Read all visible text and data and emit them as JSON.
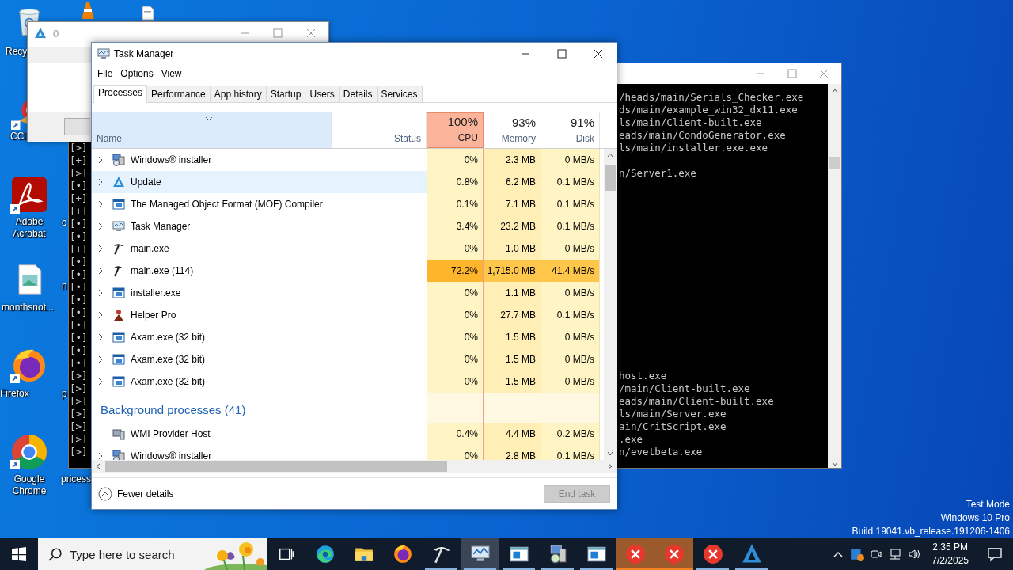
{
  "desktop": {
    "icons": [
      {
        "label": "Recy",
        "kind": "recycle"
      },
      {
        "label": "CCl",
        "kind": "cleaner"
      },
      {
        "label": "Adobe Acrobat",
        "kind": "acrobat"
      },
      {
        "label": "monthsnot...",
        "kind": "image-file"
      },
      {
        "label": "Firefox",
        "kind": "firefox"
      },
      {
        "label": "Google Chrome",
        "kind": "chrome"
      },
      {
        "kind": "cone"
      },
      {
        "kind": "document"
      },
      {
        "label": "c"
      },
      {
        "label": "n"
      },
      {
        "label": "p"
      },
      {
        "label": "pricess"
      }
    ],
    "watermark": [
      "Test Mode",
      "Windows 10 Pro",
      "Build 19041.vb_release.191206-1406"
    ]
  },
  "console": {
    "lines": [
      {
        "tail": "/heads/main/Serials_Checker.exe"
      },
      {
        "tail": "ds/main/example_win32_dx11.exe"
      },
      {
        "tail": "ls/main/Client-built.exe"
      },
      {
        "tail": "eads/main/CondoGenerator.exe"
      },
      {
        "marker": "[>]",
        "tail": "ls/main/installer.exe.exe"
      },
      {
        "marker": "[+]"
      },
      {
        "marker": "[>]",
        "tail": "n/Server1.exe"
      },
      {
        "marker": "[•]"
      },
      {
        "marker": "[+]"
      },
      {
        "marker": "[+]"
      },
      {
        "marker": "[•]"
      },
      {
        "marker": "[•]"
      },
      {
        "marker": "[+]"
      },
      {
        "marker": "[•]"
      },
      {
        "marker": "[•]"
      },
      {
        "marker": "[•]"
      },
      {
        "marker": "[•]"
      },
      {
        "marker": "[•]"
      },
      {
        "marker": "[•]"
      },
      {
        "marker": "[•]"
      },
      {
        "marker": "[•]"
      },
      {
        "marker": "[•]"
      },
      {
        "marker": "[>]",
        "tail": "host.exe"
      },
      {
        "marker": "[>]",
        "tail": "/main/Client-built.exe"
      },
      {
        "marker": "[>]",
        "tail": "eads/main/Client-built.exe"
      },
      {
        "marker": "[>]",
        "tail": "ls/main/Server.exe"
      },
      {
        "marker": "[>]",
        "tail": "ain/CritScript.exe"
      },
      {
        "marker": "[>]",
        "tail": ".exe"
      },
      {
        "marker": "[>]",
        "tail": "n/evetbeta.exe"
      }
    ]
  },
  "dialog": {
    "title": "0"
  },
  "task_manager": {
    "title": "Task Manager",
    "menu": [
      "File",
      "Options",
      "View"
    ],
    "tabs": [
      {
        "label": "Processes",
        "selected": true
      },
      {
        "label": "Performance",
        "selected": false
      },
      {
        "label": "App history",
        "selected": false
      },
      {
        "label": "Startup",
        "selected": false
      },
      {
        "label": "Users",
        "selected": false
      },
      {
        "label": "Details",
        "selected": false
      },
      {
        "label": "Services",
        "selected": false
      }
    ],
    "columns": [
      {
        "label": "Name",
        "sorted": true,
        "hot": false
      },
      {
        "label": "Status",
        "sorted": false,
        "hot": false
      },
      {
        "label": "CPU",
        "load": "100%",
        "sorted": false,
        "hot": true
      },
      {
        "label": "Memory",
        "load": "93%",
        "sorted": false,
        "hot": false
      },
      {
        "label": "Disk",
        "load": "91%",
        "sorted": false,
        "hot": false
      }
    ],
    "rows": [
      {
        "kind": "installer",
        "name": "Windows® installer",
        "expandable": true,
        "selected": false,
        "heavy": false,
        "cpu": "0%",
        "memory": "2.3 MB",
        "disk": "0 MB/s"
      },
      {
        "kind": "update",
        "name": "Update",
        "expandable": true,
        "selected": true,
        "heavy": false,
        "cpu": "0.8%",
        "memory": "6.2 MB",
        "disk": "0.1 MB/s"
      },
      {
        "kind": "window",
        "name": "The Managed Object Format (MOF) Compiler",
        "expandable": true,
        "selected": false,
        "heavy": false,
        "cpu": "0.1%",
        "memory": "7.1 MB",
        "disk": "0.1 MB/s"
      },
      {
        "kind": "monitor",
        "name": "Task Manager",
        "expandable": true,
        "selected": false,
        "heavy": false,
        "cpu": "3.4%",
        "memory": "23.2 MB",
        "disk": "0.1 MB/s"
      },
      {
        "kind": "hammer",
        "name": "main.exe",
        "expandable": true,
        "selected": false,
        "heavy": false,
        "cpu": "0%",
        "memory": "1.0 MB",
        "disk": "0 MB/s"
      },
      {
        "kind": "hammer",
        "name": "main.exe (114)",
        "expandable": true,
        "selected": false,
        "heavy": true,
        "cpu": "72.2%",
        "memory": "1,715.0 MB",
        "disk": "41.4 MB/s"
      },
      {
        "kind": "window",
        "name": "installer.exe",
        "expandable": true,
        "selected": false,
        "heavy": false,
        "cpu": "0%",
        "memory": "1.1 MB",
        "disk": "0 MB/s"
      },
      {
        "kind": "helper",
        "name": "Helper Pro",
        "expandable": true,
        "selected": false,
        "heavy": false,
        "cpu": "0%",
        "memory": "27.7 MB",
        "disk": "0.1 MB/s"
      },
      {
        "kind": "window",
        "name": "Axam.exe (32 bit)",
        "expandable": true,
        "selected": false,
        "heavy": false,
        "cpu": "0%",
        "memory": "1.5 MB",
        "disk": "0 MB/s"
      },
      {
        "kind": "window",
        "name": "Axam.exe (32 bit)",
        "expandable": true,
        "selected": false,
        "heavy": false,
        "cpu": "0%",
        "memory": "1.5 MB",
        "disk": "0 MB/s"
      },
      {
        "kind": "window",
        "name": "Axam.exe (32 bit)",
        "expandable": true,
        "selected": false,
        "heavy": false,
        "cpu": "0%",
        "memory": "1.5 MB",
        "disk": "0 MB/s"
      },
      {
        "kind": "group",
        "name": "Background processes (41)"
      },
      {
        "kind": "service",
        "name": "WMI Provider Host",
        "expandable": false,
        "selected": false,
        "heavy": false,
        "cpu": "0.4%",
        "memory": "4.4 MB",
        "disk": "0.2 MB/s"
      },
      {
        "kind": "installer",
        "name": "Windows® installer",
        "expandable": true,
        "selected": false,
        "heavy": false,
        "cpu": "0%",
        "memory": "2.8 MB",
        "disk": "0.1 MB/s"
      }
    ],
    "footer": {
      "toggle": "Fewer details",
      "end_task": {
        "label": "End task",
        "disabled": true
      }
    }
  },
  "taskbar": {
    "search": {
      "placeholder": "Type here to search"
    },
    "apps": [
      {
        "kind": "taskview",
        "running": false,
        "active": false,
        "flashing": false
      },
      {
        "kind": "edge",
        "running": false,
        "active": false,
        "flashing": false
      },
      {
        "kind": "folder",
        "running": false,
        "active": false,
        "flashing": false
      },
      {
        "kind": "firefox",
        "running": false,
        "active": false,
        "flashing": false
      },
      {
        "kind": "hammer",
        "running": true,
        "active": false,
        "flashing": false
      },
      {
        "kind": "monitor",
        "running": true,
        "active": true,
        "flashing": false
      },
      {
        "kind": "window",
        "running": true,
        "active": false,
        "flashing": false
      },
      {
        "kind": "installer",
        "running": true,
        "active": false,
        "flashing": false
      },
      {
        "kind": "window",
        "running": true,
        "active": false,
        "flashing": false
      },
      {
        "kind": "error",
        "running": true,
        "active": false,
        "flashing": true
      },
      {
        "kind": "error",
        "running": true,
        "active": false,
        "flashing": true
      },
      {
        "kind": "error",
        "running": true,
        "active": false,
        "flashing": false
      },
      {
        "kind": "triangle",
        "running": true,
        "active": false,
        "flashing": false
      }
    ],
    "tray": {
      "time": "2:35 PM",
      "date": "7/2/2025"
    }
  }
}
